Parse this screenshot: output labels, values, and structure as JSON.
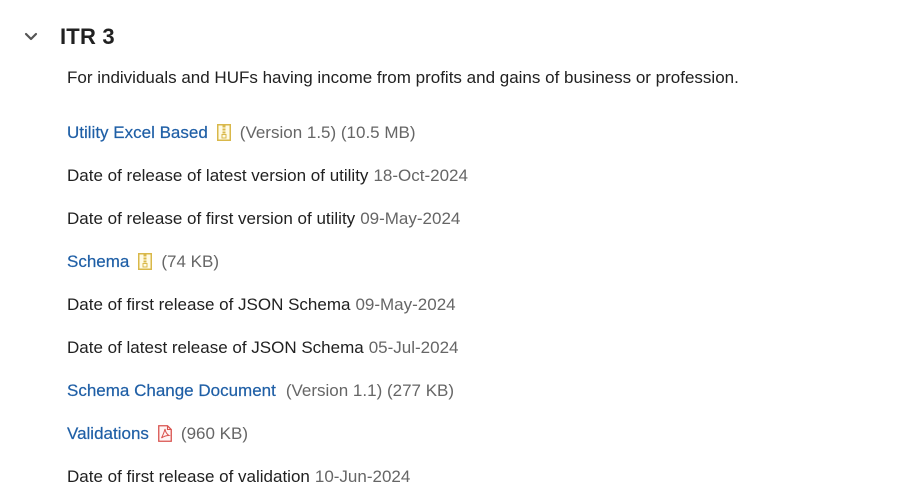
{
  "section": {
    "title": "ITR 3",
    "description": "For individuals and HUFs having income from profits and gains of business or profession."
  },
  "utility": {
    "link_label": "Utility Excel Based",
    "icon": "zip-file-icon",
    "meta": "(Version 1.5) (10.5 MB)"
  },
  "utility_latest": {
    "label": "Date of release of latest version of utility",
    "date": "18-Oct-2024"
  },
  "utility_first": {
    "label": "Date of release of first version of utility",
    "date": "09-May-2024"
  },
  "schema": {
    "link_label": "Schema",
    "icon": "zip-file-icon",
    "meta": "(74 KB)"
  },
  "schema_first": {
    "label": "Date of first release of JSON Schema",
    "date": "09-May-2024"
  },
  "schema_latest": {
    "label": "Date of latest release of JSON Schema",
    "date": "05-Jul-2024"
  },
  "schema_change": {
    "link_label": "Schema Change Document",
    "meta": "(Version 1.1) (277 KB)"
  },
  "validations": {
    "link_label": "Validations",
    "icon": "pdf-file-icon",
    "meta": "(960 KB)"
  },
  "validation_first": {
    "label": "Date of first release of validation",
    "date": "10-Jun-2024"
  },
  "colors": {
    "link": "#1f5fa6",
    "muted": "#666666",
    "zip_icon": "#d9b84a",
    "pdf_icon": "#d9534f"
  }
}
